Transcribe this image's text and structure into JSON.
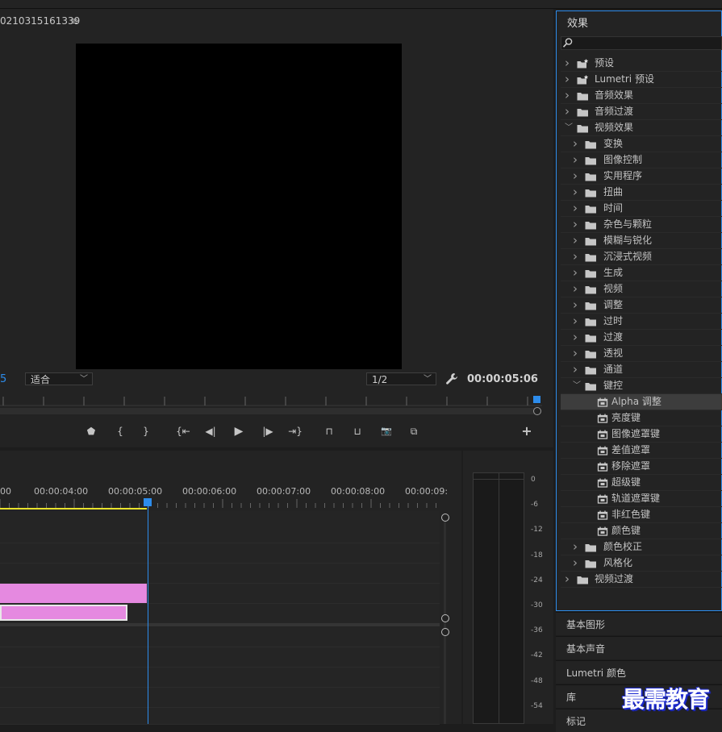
{
  "program_monitor": {
    "title": "0210315161339",
    "menu_glyph": "≡",
    "left_timecode_fragment": "5",
    "fit_select": "适合",
    "resolution_select": "1/2",
    "timecode": "00:00:05:06"
  },
  "transport_controls": [
    {
      "name": "marker-button",
      "glyph": "⬟"
    },
    {
      "name": "mark-in-button",
      "glyph": "{"
    },
    {
      "name": "mark-out-button",
      "glyph": "}"
    },
    {
      "name": "go-to-in-button",
      "glyph": "{⇤"
    },
    {
      "name": "step-back-button",
      "glyph": "◀|"
    },
    {
      "name": "play-button",
      "glyph": "▶"
    },
    {
      "name": "step-forward-button",
      "glyph": "|▶"
    },
    {
      "name": "go-to-out-button",
      "glyph": "⇥}"
    },
    {
      "name": "lift-button",
      "glyph": "⊓"
    },
    {
      "name": "extract-button",
      "glyph": "⊔"
    },
    {
      "name": "export-frame-button",
      "glyph": "📷"
    },
    {
      "name": "compare-view-button",
      "glyph": "⧉"
    },
    {
      "name": "add-button",
      "glyph": "+"
    }
  ],
  "timeline": {
    "ruler_times": [
      "00",
      "00:00:04:00",
      "00:00:05:00",
      "00:00:06:00",
      "00:00:07:00",
      "00:00:08:00",
      "00:00:09:"
    ]
  },
  "audio_meter": {
    "db_labels": [
      "0",
      "-6",
      "-12",
      "-18",
      "-24",
      "-30",
      "-36",
      "-42",
      "-48",
      "-54"
    ]
  },
  "effects_panel": {
    "title": "效果",
    "tree": [
      {
        "label": "预设",
        "level": 0,
        "icon": "preset-folder-icon",
        "expanded": false
      },
      {
        "label": "Lumetri 预设",
        "level": 0,
        "icon": "preset-folder-icon",
        "expanded": false
      },
      {
        "label": "音频效果",
        "level": 0,
        "icon": "folder-icon",
        "expanded": false
      },
      {
        "label": "音频过渡",
        "level": 0,
        "icon": "folder-icon",
        "expanded": false
      },
      {
        "label": "视频效果",
        "level": 0,
        "icon": "folder-icon",
        "expanded": true
      },
      {
        "label": "变换",
        "level": 1,
        "icon": "folder-icon",
        "expanded": false
      },
      {
        "label": "图像控制",
        "level": 1,
        "icon": "folder-icon",
        "expanded": false
      },
      {
        "label": "实用程序",
        "level": 1,
        "icon": "folder-icon",
        "expanded": false
      },
      {
        "label": "扭曲",
        "level": 1,
        "icon": "folder-icon",
        "expanded": false
      },
      {
        "label": "时间",
        "level": 1,
        "icon": "folder-icon",
        "expanded": false
      },
      {
        "label": "杂色与颗粒",
        "level": 1,
        "icon": "folder-icon",
        "expanded": false
      },
      {
        "label": "模糊与锐化",
        "level": 1,
        "icon": "folder-icon",
        "expanded": false
      },
      {
        "label": "沉浸式视频",
        "level": 1,
        "icon": "folder-icon",
        "expanded": false
      },
      {
        "label": "生成",
        "level": 1,
        "icon": "folder-icon",
        "expanded": false
      },
      {
        "label": "视频",
        "level": 1,
        "icon": "folder-icon",
        "expanded": false
      },
      {
        "label": "调整",
        "level": 1,
        "icon": "folder-icon",
        "expanded": false
      },
      {
        "label": "过时",
        "level": 1,
        "icon": "folder-icon",
        "expanded": false
      },
      {
        "label": "过渡",
        "level": 1,
        "icon": "folder-icon",
        "expanded": false
      },
      {
        "label": "透视",
        "level": 1,
        "icon": "folder-icon",
        "expanded": false
      },
      {
        "label": "通道",
        "level": 1,
        "icon": "folder-icon",
        "expanded": false
      },
      {
        "label": "键控",
        "level": 1,
        "icon": "folder-icon",
        "expanded": true
      },
      {
        "label": "Alpha 调整",
        "level": 2,
        "icon": "effect-icon",
        "selected": true
      },
      {
        "label": "亮度键",
        "level": 2,
        "icon": "effect-icon"
      },
      {
        "label": "图像遮罩键",
        "level": 2,
        "icon": "effect-icon"
      },
      {
        "label": "差值遮罩",
        "level": 2,
        "icon": "effect-icon"
      },
      {
        "label": "移除遮罩",
        "level": 2,
        "icon": "effect-icon"
      },
      {
        "label": "超级键",
        "level": 2,
        "icon": "effect-icon"
      },
      {
        "label": "轨道遮罩键",
        "level": 2,
        "icon": "effect-icon"
      },
      {
        "label": "非红色键",
        "level": 2,
        "icon": "effect-icon"
      },
      {
        "label": "颜色键",
        "level": 2,
        "icon": "effect-icon"
      },
      {
        "label": "颜色校正",
        "level": 1,
        "icon": "folder-icon",
        "expanded": false
      },
      {
        "label": "风格化",
        "level": 1,
        "icon": "folder-icon",
        "expanded": false
      },
      {
        "label": "视频过渡",
        "level": 0,
        "icon": "folder-icon",
        "expanded": false
      }
    ]
  },
  "side_tabs": [
    "基本图形",
    "基本声音",
    "Lumetri 颜色",
    "库",
    "标记"
  ],
  "watermark": "最需教育",
  "colors": {
    "accent_blue": "#2d8ceb",
    "clip_pink": "#e589e0",
    "work_area_yellow": "#e8e22c",
    "panel_bg": "#232323"
  }
}
